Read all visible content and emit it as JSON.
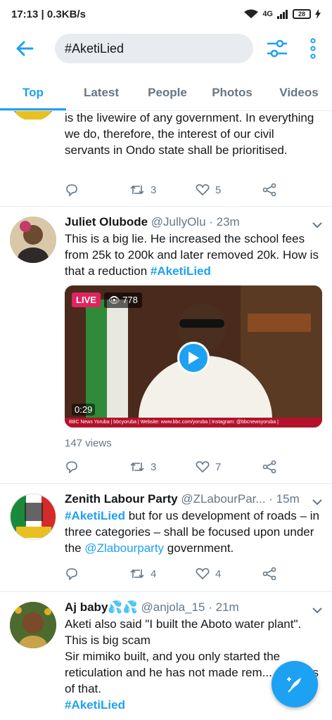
{
  "status": {
    "time_speed": "17:13 | 0.3KB/s",
    "battery": "28",
    "network": "4G"
  },
  "search": {
    "query": "#AketiLied"
  },
  "tabs": [
    "Top",
    "Latest",
    "People",
    "Photos",
    "Videos"
  ],
  "tweets": [
    {
      "text": "is the livewire of any government. In everything we do, therefore, the interest of our civil servants in Ondo state shall be prioritised.",
      "replies": "",
      "retweets": "3",
      "likes": "5"
    },
    {
      "name": "Juliet Olubode",
      "handle": "@JullyOlu · 23m",
      "text": "This is a big lie. He increased the school fees from 25k to 200k and later removed 20k. How is that a reduction ",
      "hashtag": "#AketiLied",
      "video": {
        "live": "LIVE",
        "viewers": "778",
        "duration": "0:29",
        "caption": "BBC News Yoruba | bbcyoruba | Website: www.bbc.com/yoruba | Instagram: @bbcnewsyoruba |"
      },
      "views": "147 views",
      "replies": "",
      "retweets": "3",
      "likes": "7"
    },
    {
      "name": "Zenith Labour Party",
      "handle": "@ZLabourPar... · 15m",
      "hashtag": "#AketiLied",
      "text": " but for us development of roads – in three categories – shall be focused upon under the ",
      "mention": "@Zlabourparty",
      "text_end": " government.",
      "replies": "",
      "retweets": "4",
      "likes": "4"
    },
    {
      "name": "Aj baby💦💦",
      "handle": "@anjola_15 · 21m",
      "text": "Aketi also said \"I built the Aboto water plant\". This is big scam\n Sir mimiko built, and you only started the reticulation and he has not made rem... success of that.",
      "hashtag": "#AketiLied"
    }
  ],
  "colors": {
    "accent": "#1da1f2",
    "secondary_text": "#657786"
  }
}
